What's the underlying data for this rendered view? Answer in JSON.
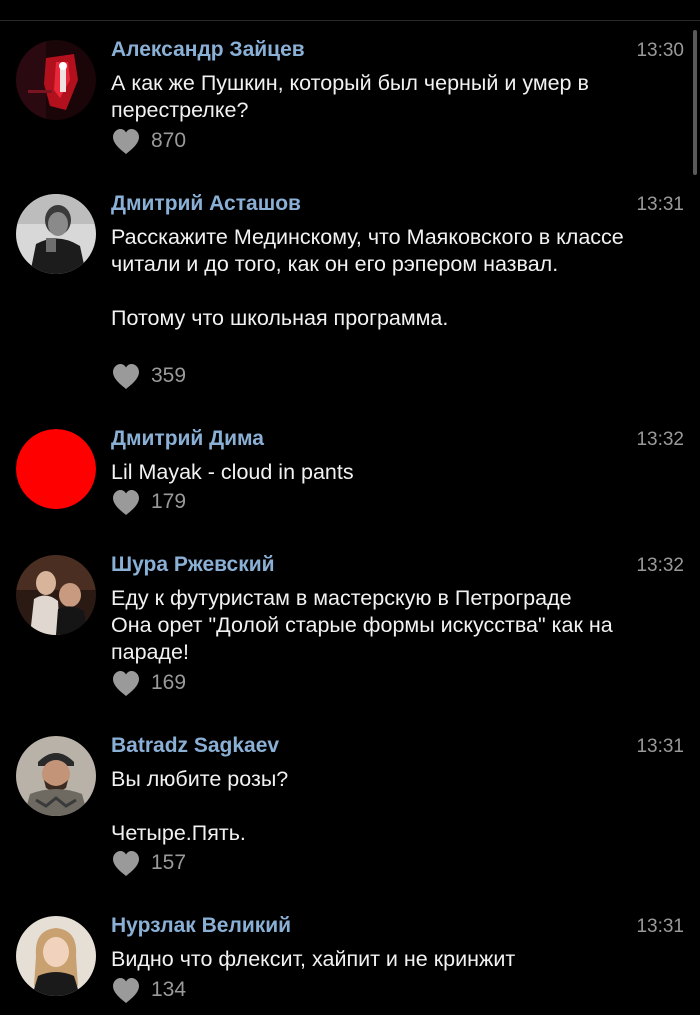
{
  "colors": {
    "background": "#000000",
    "author": "#8ab0d6",
    "meta": "#9a9a9a",
    "text": "#f2f2f2"
  },
  "comments": [
    {
      "author": "Александр Зайцев",
      "time": "13:30",
      "text": "А как же Пушкин, который был черный и умер в перестрелке?",
      "likes": "870",
      "avatar": "dark-red-artwork-avatar"
    },
    {
      "author": "Дмитрий Асташов",
      "time": "13:31",
      "text": "Расскажите Мединскому, что Маяковского в классе читали и до того, как он его рэпером назвал.\n\nПотому что школьная программа.",
      "likes": "359",
      "avatar": "bw-photo-avatar"
    },
    {
      "author": "Дмитрий Дима",
      "time": "13:32",
      "text": "Lil Mayak - cloud in pants",
      "likes": "179",
      "avatar": "red-circle-avatar"
    },
    {
      "author": "Шура Ржевский",
      "time": "13:32",
      "text": "Еду к футуристам в мастерскую в Петрограде\nОна орет \"Долой старые формы искусства\" как на параде!",
      "likes": "169",
      "avatar": "two-men-photo-avatar"
    },
    {
      "author": "Batradz Sagkaev",
      "time": "13:31",
      "text": "Вы любите розы?\n\nЧетыре.Пять.",
      "likes": "157",
      "avatar": "man-in-cap-photo-avatar"
    },
    {
      "author": "Нурзлак Великий",
      "time": "13:31",
      "text": "Видно что флексит, хайпит и не кринжит",
      "likes": "134",
      "avatar": "woman-photo-avatar"
    }
  ]
}
